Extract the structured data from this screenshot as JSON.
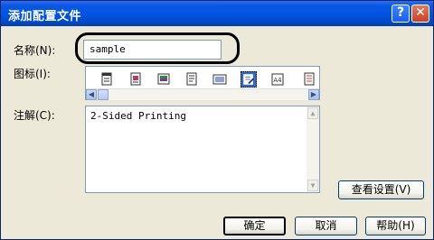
{
  "window": {
    "title": "添加配置文件",
    "help_button": "?",
    "close_button": "✕"
  },
  "fields": {
    "name_label": "名称(N):",
    "name_value": "sample",
    "icon_label": "图标(I):",
    "comment_label": "注解(C):",
    "comment_value": "2-Sided Printing"
  },
  "icons": [
    "document-icon",
    "photo-document-icon",
    "image-icon",
    "page-icon",
    "text-document-icon",
    "edit-document-icon",
    "a4-paper-icon",
    "list-document-icon"
  ],
  "buttons": {
    "view_settings": "查看设置(V)",
    "ok": "确定",
    "cancel": "取消",
    "help": "帮助(H)"
  },
  "colors": {
    "titlebar": "#0054e3",
    "dialog_bg": "#ece9d8",
    "selected_icon": "#316ac5"
  }
}
